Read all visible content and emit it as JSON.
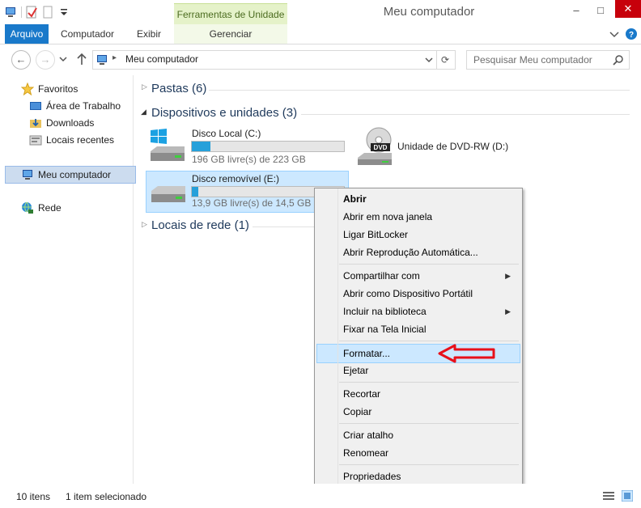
{
  "window": {
    "title": "Meu computador",
    "context_tab_header": "Ferramentas de Unidade",
    "minimize": "–",
    "maximize": "□",
    "close": "✕"
  },
  "ribbon": {
    "tabs": [
      "Arquivo",
      "Computador",
      "Exibir",
      "Gerenciar"
    ],
    "active_tab": "Arquivo"
  },
  "address": {
    "path": "Meu computador",
    "search_placeholder": "Pesquisar Meu computador"
  },
  "sidebar": {
    "favorites_label": "Favoritos",
    "favorites": [
      "Área de Trabalho",
      "Downloads",
      "Locais recentes"
    ],
    "this_pc": "Meu computador",
    "network": "Rede"
  },
  "groups": {
    "folders": "Pastas (6)",
    "devices": "Dispositivos e unidades (3)",
    "network_locations": "Locais de rede (1)"
  },
  "drives": [
    {
      "name": "Disco Local (C:)",
      "free_text": "196 GB livre(s) de 223 GB",
      "used_fraction": 0.12
    },
    {
      "name": "Unidade de DVD-RW (D:)"
    },
    {
      "name": "Disco removível (E:)",
      "free_text": "13,9 GB livre(s) de 14,5 GB",
      "used_fraction": 0.04
    }
  ],
  "context_menu": {
    "items": [
      "Abrir",
      "Abrir em nova janela",
      "Ligar BitLocker",
      "Abrir Reprodução Automática...",
      "Compartilhar com",
      "Abrir como Dispositivo Portátil",
      "Incluir na biblioteca",
      "Fixar na Tela Inicial",
      "Formatar...",
      "Ejetar",
      "Recortar",
      "Copiar",
      "Criar atalho",
      "Renomear",
      "Propriedades"
    ],
    "highlighted": "Formatar..."
  },
  "status": {
    "item_count": "10 itens",
    "selected": "1 item selecionado"
  },
  "colors": {
    "accent": "#1979ca",
    "selection": "#cce8ff",
    "drive_bar": "#26a0da",
    "annotation_arrow": "#e8101a"
  }
}
